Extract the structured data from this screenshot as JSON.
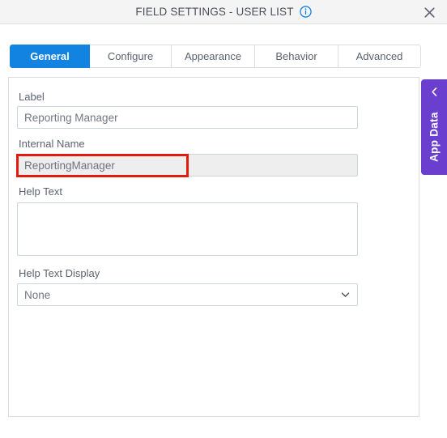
{
  "window": {
    "title": "FIELD SETTINGS - USER LIST",
    "info_icon": "info-circle-icon",
    "close_icon": "close-icon"
  },
  "tabs": [
    {
      "label": "General",
      "active": true
    },
    {
      "label": "Configure",
      "active": false
    },
    {
      "label": "Appearance",
      "active": false
    },
    {
      "label": "Behavior",
      "active": false
    },
    {
      "label": "Advanced",
      "active": false
    }
  ],
  "form": {
    "label_field": {
      "label": "Label",
      "value": "Reporting Manager",
      "placeholder": ""
    },
    "internal_name_field": {
      "label": "Internal Name",
      "value": "ReportingManager",
      "placeholder": "",
      "disabled": true
    },
    "help_text_field": {
      "label": "Help Text",
      "value": "",
      "placeholder": ""
    },
    "help_text_display_field": {
      "label": "Help Text Display",
      "value": "None",
      "options": [
        "None"
      ],
      "chevron_icon": "chevron-down-icon"
    }
  },
  "side_panel": {
    "label": "App Data",
    "chevron": "‹",
    "chevron_icon": "chevron-left-icon",
    "color": "#6a3fd0"
  },
  "annotation": {
    "color": "#e11b10",
    "target": "internal-name-input"
  },
  "colors": {
    "accent": "#1383e2",
    "titlebar": "#f4f4f4",
    "panel_border": "#d9dce3",
    "disabled_input": "#eeeeee"
  }
}
